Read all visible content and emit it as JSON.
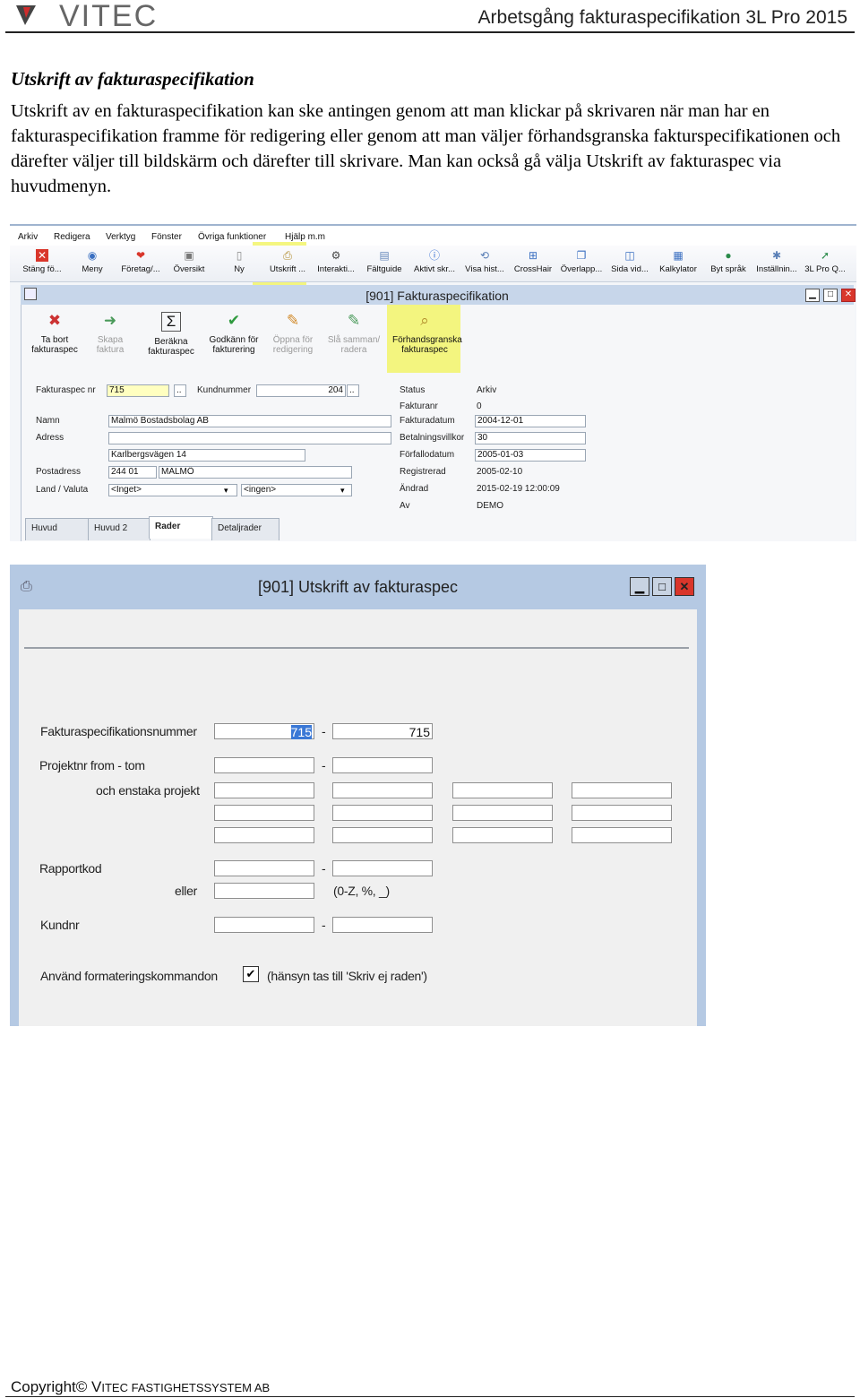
{
  "header": {
    "logo_text": "VITEC",
    "title": "Arbetsgång fakturaspecifikation 3L Pro 2015"
  },
  "section_title": "Utskrift av fakturaspecifikation",
  "body_text": "Utskrift av en fakturaspecifikation kan ske antingen genom att man klickar på skrivaren när man har en fakturaspecifikation framme för redigering eller genom att man väljer förhandsgranska fakturspecifikationen och därefter väljer till bildskärm och därefter till skrivare. Man kan också gå välja Utskrift av fakturaspec via huvudmenyn.",
  "shot1": {
    "menu": [
      "Arkiv",
      "Redigera",
      "Verktyg",
      "Fönster",
      "Övriga funktioner",
      "Hjälp m.m"
    ],
    "toolbar": [
      "Stäng fö...",
      "Meny",
      "Företag/...",
      "Översikt",
      "Ny",
      "Utskrift ...",
      "Interakti...",
      "Fältguide",
      "Aktivt skr...",
      "Visa hist...",
      "CrossHair",
      "Överlapp...",
      "Sida vid...",
      "Kalkylator",
      "Byt språk",
      "Inställnin...",
      "3L Pro Q..."
    ],
    "window_title": "[901]  Fakturaspecifikation",
    "ribbon": [
      {
        "l1": "Ta bort",
        "l2": "fakturaspec"
      },
      {
        "l1": "Skapa",
        "l2": "faktura"
      },
      {
        "l1": "Beräkna",
        "l2": "fakturaspec"
      },
      {
        "l1": "Godkänn för",
        "l2": "fakturering"
      },
      {
        "l1": "Öppna för",
        "l2": "redigering"
      },
      {
        "l1": "Slå samman/",
        "l2": "radera"
      },
      {
        "l1": "Förhandsgranska",
        "l2": "fakturaspec"
      }
    ],
    "form": {
      "fakturaspec_nr_label": "Fakturaspec nr",
      "fakturaspec_nr": "715",
      "kundnummer_label": "Kundnummer",
      "kundnummer": "204",
      "namn_label": "Namn",
      "namn": "Malmö Bostadsbolag AB",
      "adress_label": "Adress",
      "adress1": "",
      "adress2": "Karlbergsvägen 14",
      "postadress_label": "Postadress",
      "postnr": "244 01",
      "ort": "MALMÖ",
      "land_label": "Land / Valuta",
      "land": "<Inget>",
      "valuta": "<ingen>",
      "status_label": "Status",
      "status": "Arkiv",
      "fakturanr_label": "Fakturanr",
      "fakturanr": "0",
      "fakturadatum_label": "Fakturadatum",
      "fakturadatum": "2004-12-01",
      "betalningsvillkor_label": "Betalningsvillkor",
      "betalningsvillkor": "30",
      "forfallodatum_label": "Förfallodatum",
      "forfallodatum": "2005-01-03",
      "registrerad_label": "Registrerad",
      "registrerad": "2005-02-10",
      "andrad_label": "Ändrad",
      "andrad": "2015-02-19 12:00:09",
      "av_label": "Av",
      "av": "DEMO"
    },
    "tabs": [
      "Huvud",
      "Huvud 2",
      "Rader",
      "Detaljrader"
    ]
  },
  "shot2": {
    "window_title": "[901]  Utskrift av fakturaspec",
    "labels": {
      "fakturaspecnr": "Fakturaspecifikationsnummer",
      "projektnr": "Projektnr from - tom",
      "enstaka": "och enstaka projekt",
      "rapportkod": "Rapportkod",
      "eller": "eller",
      "pattern_hint": "(0-Z, %, _)",
      "kundnr": "Kundnr",
      "formatering": "Använd formateringskommandon",
      "formatering_hint": "(hänsyn tas till 'Skriv ej raden')"
    },
    "values": {
      "from": "715",
      "to": "715"
    },
    "dash": "-",
    "use_formatting": true
  },
  "footer": {
    "copyright": "Copyright©",
    "company_initial": "V",
    "company_rest": "ITEC FASTIGHETSSYSTEM AB"
  },
  "colors": {
    "highlight": "#f2f46a",
    "titlebar": "#c7d6ea",
    "close": "#d9362b"
  }
}
